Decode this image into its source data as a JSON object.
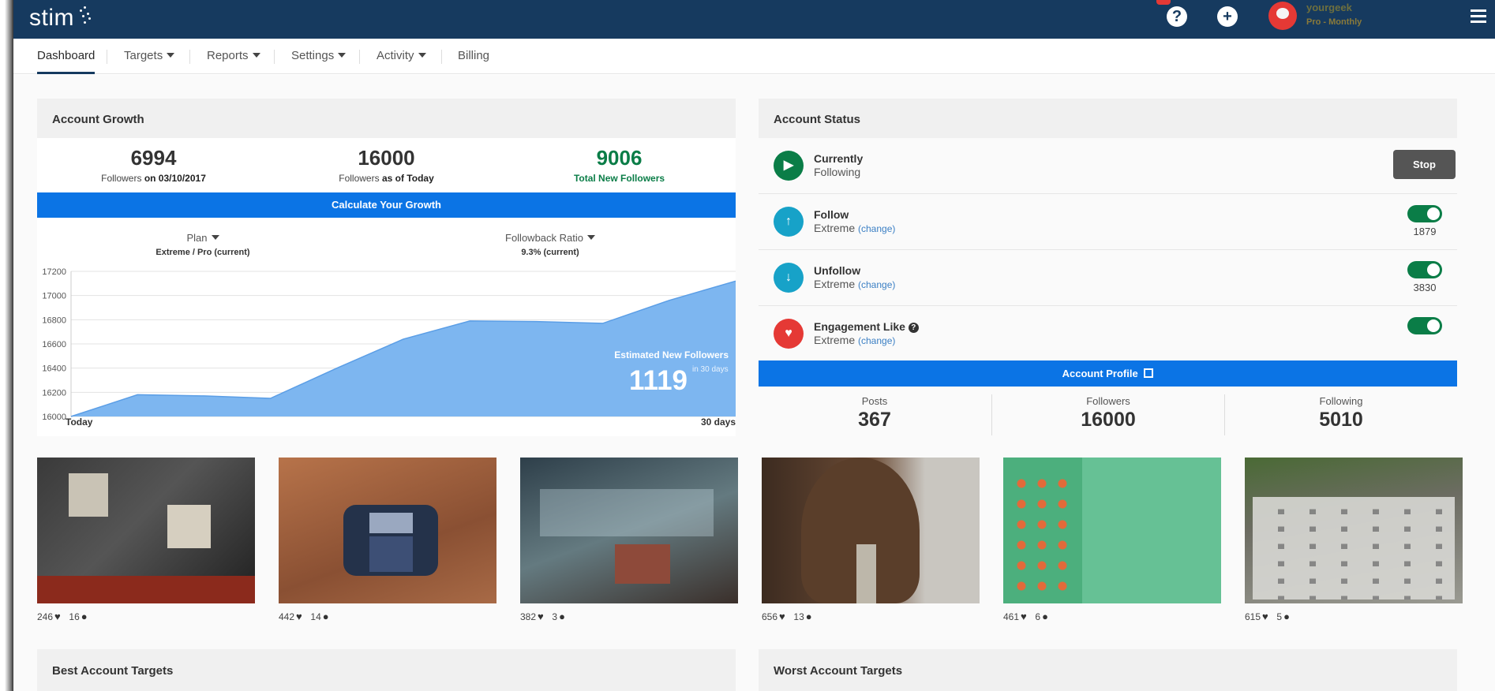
{
  "app": {
    "logo": "stim"
  },
  "topbar": {
    "help_icon": "question-circle-icon",
    "add_icon": "plus-circle-icon",
    "username": "yourgeek",
    "plan": "Pro - Monthly",
    "menu_icon": "hamburger-icon"
  },
  "nav": {
    "items": [
      {
        "label": "Dashboard",
        "active": true
      },
      {
        "label": "Targets",
        "dropdown": true
      },
      {
        "label": "Reports",
        "dropdown": true
      },
      {
        "label": "Settings",
        "dropdown": true
      },
      {
        "label": "Activity",
        "dropdown": true
      },
      {
        "label": "Billing"
      }
    ]
  },
  "growth": {
    "title": "Account Growth",
    "stats": [
      {
        "value": "6994",
        "label": "Followers",
        "bold": "on 03/10/2017"
      },
      {
        "value": "16000",
        "label": "Followers",
        "bold": "as of Today"
      },
      {
        "value": "9006",
        "label": "",
        "bold": "Total New Followers"
      }
    ],
    "calc_button": "Calculate Your Growth",
    "plan_label": "Plan",
    "plan_value": "Extreme / Pro (current)",
    "ratio_label": "Followback Ratio",
    "ratio_value": "9.3% (current)",
    "estimate_label": "Estimated New Followers",
    "estimate_value": "1119",
    "estimate_suffix": "in 30 days",
    "x_start": "Today",
    "x_end": "30 days"
  },
  "chart_data": {
    "type": "area",
    "x": [
      0,
      3,
      6,
      9,
      12,
      15,
      18,
      21,
      24,
      27,
      30
    ],
    "values": [
      16000,
      16180,
      16170,
      16150,
      16400,
      16640,
      16790,
      16785,
      16770,
      16960,
      17120
    ],
    "ylim": [
      16000,
      17200
    ],
    "yticks": [
      "17200",
      "17000",
      "16800",
      "16600",
      "16400",
      "16200",
      "16000"
    ],
    "color": "#7db6f0",
    "grid": true
  },
  "status": {
    "title": "Account Status",
    "rows": [
      {
        "title": "Currently",
        "sub": "Following",
        "icon": "play-icon",
        "color": "#0a7d47"
      },
      {
        "title": "Follow",
        "sub": "Extreme",
        "change": "(change)",
        "icon": "arrow-up-icon",
        "color": "#17a2c8",
        "count": "1879"
      },
      {
        "title": "Unfollow",
        "sub": "Extreme",
        "change": "(change)",
        "icon": "arrow-down-icon",
        "color": "#17a2c8",
        "count": "3830"
      },
      {
        "title": "Engagement Like",
        "sub": "Extreme",
        "change": "(change)",
        "icon": "heart-icon",
        "color": "#e53935"
      }
    ],
    "stop_button": "Stop",
    "profile_button": "Account Profile",
    "profile": [
      {
        "label": "Posts",
        "value": "367"
      },
      {
        "label": "Followers",
        "value": "16000"
      },
      {
        "label": "Following",
        "value": "5010"
      }
    ]
  },
  "photos": [
    {
      "likes": "246",
      "comments": "16"
    },
    {
      "likes": "442",
      "comments": "14"
    },
    {
      "likes": "382",
      "comments": "3"
    },
    {
      "likes": "656",
      "comments": "13"
    },
    {
      "likes": "461",
      "comments": "6"
    },
    {
      "likes": "615",
      "comments": "5"
    }
  ],
  "bottom": {
    "left": "Best Account Targets",
    "right": "Worst Account Targets"
  }
}
